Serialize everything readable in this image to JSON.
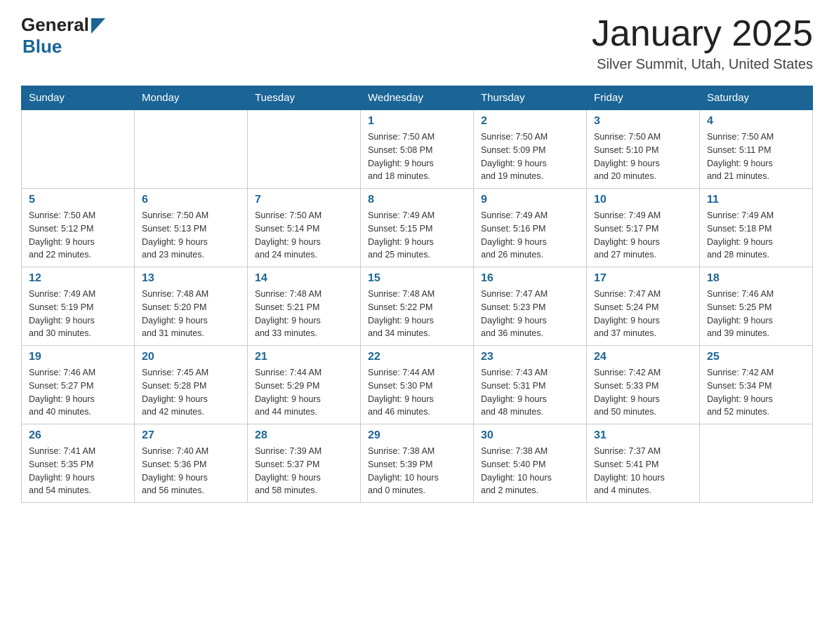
{
  "header": {
    "logo_general": "General",
    "logo_blue": "Blue",
    "title": "January 2025",
    "subtitle": "Silver Summit, Utah, United States"
  },
  "days_of_week": [
    "Sunday",
    "Monday",
    "Tuesday",
    "Wednesday",
    "Thursday",
    "Friday",
    "Saturday"
  ],
  "weeks": [
    [
      {
        "day": "",
        "info": ""
      },
      {
        "day": "",
        "info": ""
      },
      {
        "day": "",
        "info": ""
      },
      {
        "day": "1",
        "info": "Sunrise: 7:50 AM\nSunset: 5:08 PM\nDaylight: 9 hours\nand 18 minutes."
      },
      {
        "day": "2",
        "info": "Sunrise: 7:50 AM\nSunset: 5:09 PM\nDaylight: 9 hours\nand 19 minutes."
      },
      {
        "day": "3",
        "info": "Sunrise: 7:50 AM\nSunset: 5:10 PM\nDaylight: 9 hours\nand 20 minutes."
      },
      {
        "day": "4",
        "info": "Sunrise: 7:50 AM\nSunset: 5:11 PM\nDaylight: 9 hours\nand 21 minutes."
      }
    ],
    [
      {
        "day": "5",
        "info": "Sunrise: 7:50 AM\nSunset: 5:12 PM\nDaylight: 9 hours\nand 22 minutes."
      },
      {
        "day": "6",
        "info": "Sunrise: 7:50 AM\nSunset: 5:13 PM\nDaylight: 9 hours\nand 23 minutes."
      },
      {
        "day": "7",
        "info": "Sunrise: 7:50 AM\nSunset: 5:14 PM\nDaylight: 9 hours\nand 24 minutes."
      },
      {
        "day": "8",
        "info": "Sunrise: 7:49 AM\nSunset: 5:15 PM\nDaylight: 9 hours\nand 25 minutes."
      },
      {
        "day": "9",
        "info": "Sunrise: 7:49 AM\nSunset: 5:16 PM\nDaylight: 9 hours\nand 26 minutes."
      },
      {
        "day": "10",
        "info": "Sunrise: 7:49 AM\nSunset: 5:17 PM\nDaylight: 9 hours\nand 27 minutes."
      },
      {
        "day": "11",
        "info": "Sunrise: 7:49 AM\nSunset: 5:18 PM\nDaylight: 9 hours\nand 28 minutes."
      }
    ],
    [
      {
        "day": "12",
        "info": "Sunrise: 7:49 AM\nSunset: 5:19 PM\nDaylight: 9 hours\nand 30 minutes."
      },
      {
        "day": "13",
        "info": "Sunrise: 7:48 AM\nSunset: 5:20 PM\nDaylight: 9 hours\nand 31 minutes."
      },
      {
        "day": "14",
        "info": "Sunrise: 7:48 AM\nSunset: 5:21 PM\nDaylight: 9 hours\nand 33 minutes."
      },
      {
        "day": "15",
        "info": "Sunrise: 7:48 AM\nSunset: 5:22 PM\nDaylight: 9 hours\nand 34 minutes."
      },
      {
        "day": "16",
        "info": "Sunrise: 7:47 AM\nSunset: 5:23 PM\nDaylight: 9 hours\nand 36 minutes."
      },
      {
        "day": "17",
        "info": "Sunrise: 7:47 AM\nSunset: 5:24 PM\nDaylight: 9 hours\nand 37 minutes."
      },
      {
        "day": "18",
        "info": "Sunrise: 7:46 AM\nSunset: 5:25 PM\nDaylight: 9 hours\nand 39 minutes."
      }
    ],
    [
      {
        "day": "19",
        "info": "Sunrise: 7:46 AM\nSunset: 5:27 PM\nDaylight: 9 hours\nand 40 minutes."
      },
      {
        "day": "20",
        "info": "Sunrise: 7:45 AM\nSunset: 5:28 PM\nDaylight: 9 hours\nand 42 minutes."
      },
      {
        "day": "21",
        "info": "Sunrise: 7:44 AM\nSunset: 5:29 PM\nDaylight: 9 hours\nand 44 minutes."
      },
      {
        "day": "22",
        "info": "Sunrise: 7:44 AM\nSunset: 5:30 PM\nDaylight: 9 hours\nand 46 minutes."
      },
      {
        "day": "23",
        "info": "Sunrise: 7:43 AM\nSunset: 5:31 PM\nDaylight: 9 hours\nand 48 minutes."
      },
      {
        "day": "24",
        "info": "Sunrise: 7:42 AM\nSunset: 5:33 PM\nDaylight: 9 hours\nand 50 minutes."
      },
      {
        "day": "25",
        "info": "Sunrise: 7:42 AM\nSunset: 5:34 PM\nDaylight: 9 hours\nand 52 minutes."
      }
    ],
    [
      {
        "day": "26",
        "info": "Sunrise: 7:41 AM\nSunset: 5:35 PM\nDaylight: 9 hours\nand 54 minutes."
      },
      {
        "day": "27",
        "info": "Sunrise: 7:40 AM\nSunset: 5:36 PM\nDaylight: 9 hours\nand 56 minutes."
      },
      {
        "day": "28",
        "info": "Sunrise: 7:39 AM\nSunset: 5:37 PM\nDaylight: 9 hours\nand 58 minutes."
      },
      {
        "day": "29",
        "info": "Sunrise: 7:38 AM\nSunset: 5:39 PM\nDaylight: 10 hours\nand 0 minutes."
      },
      {
        "day": "30",
        "info": "Sunrise: 7:38 AM\nSunset: 5:40 PM\nDaylight: 10 hours\nand 2 minutes."
      },
      {
        "day": "31",
        "info": "Sunrise: 7:37 AM\nSunset: 5:41 PM\nDaylight: 10 hours\nand 4 minutes."
      },
      {
        "day": "",
        "info": ""
      }
    ]
  ]
}
